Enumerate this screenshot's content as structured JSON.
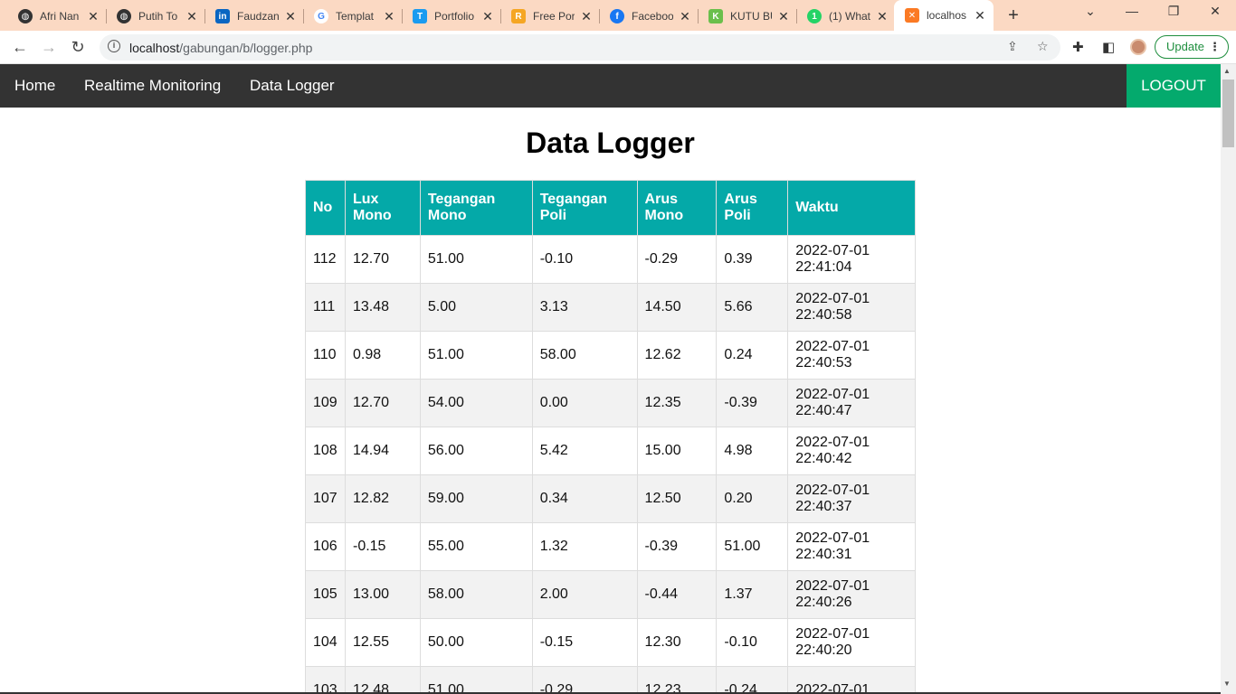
{
  "browser": {
    "tabs": [
      {
        "title": "Afri Nan",
        "icon": "globe-icon"
      },
      {
        "title": "Putih To",
        "icon": "globe-icon"
      },
      {
        "title": "Faudzan",
        "icon": "linkedin-icon"
      },
      {
        "title": "Templat",
        "icon": "google-icon"
      },
      {
        "title": "Portfolio",
        "icon": "t-app-icon"
      },
      {
        "title": "Free Por",
        "icon": "r-app-icon"
      },
      {
        "title": "Faceboo",
        "icon": "facebook-icon"
      },
      {
        "title": "KUTU BU",
        "icon": "app-icon"
      },
      {
        "title": "(1) What",
        "icon": "whatsapp-icon"
      },
      {
        "title": "localhos",
        "icon": "xampp-icon"
      }
    ],
    "url_host": "localhost",
    "url_path": "/gabungan/b/logger.php",
    "update_label": "Update"
  },
  "nav": {
    "home": "Home",
    "realtime": "Realtime Monitoring",
    "logger": "Data Logger",
    "logout": "LOGOUT"
  },
  "page": {
    "title": "Data Logger"
  },
  "table": {
    "headers": [
      [
        "No",
        ""
      ],
      [
        "Lux",
        "Mono"
      ],
      [
        "Tegangan",
        "Mono"
      ],
      [
        "Tegangan",
        "Poli"
      ],
      [
        "Arus",
        "Mono"
      ],
      [
        "Arus",
        "Poli"
      ],
      [
        "Waktu",
        ""
      ]
    ],
    "rows": [
      [
        "112",
        "12.70",
        "51.00",
        "-0.10",
        "-0.29",
        "0.39",
        "2022-07-01",
        "22:41:04"
      ],
      [
        "111",
        "13.48",
        "5.00",
        "3.13",
        "14.50",
        "5.66",
        "2022-07-01",
        "22:40:58"
      ],
      [
        "110",
        "0.98",
        "51.00",
        "58.00",
        "12.62",
        "0.24",
        "2022-07-01",
        "22:40:53"
      ],
      [
        "109",
        "12.70",
        "54.00",
        "0.00",
        "12.35",
        "-0.39",
        "2022-07-01",
        "22:40:47"
      ],
      [
        "108",
        "14.94",
        "56.00",
        "5.42",
        "15.00",
        "4.98",
        "2022-07-01",
        "22:40:42"
      ],
      [
        "107",
        "12.82",
        "59.00",
        "0.34",
        "12.50",
        "0.20",
        "2022-07-01",
        "22:40:37"
      ],
      [
        "106",
        "-0.15",
        "55.00",
        "1.32",
        "-0.39",
        "51.00",
        "2022-07-01",
        "22:40:31"
      ],
      [
        "105",
        "13.00",
        "58.00",
        "2.00",
        "-0.44",
        "1.37",
        "2022-07-01",
        "22:40:26"
      ],
      [
        "104",
        "12.55",
        "50.00",
        "-0.15",
        "12.30",
        "-0.10",
        "2022-07-01",
        "22:40:20"
      ],
      [
        "103",
        "12.48",
        "51.00",
        "-0.29",
        "12.23",
        "-0.24",
        "2022-07-01",
        ""
      ]
    ]
  },
  "colors": {
    "nav_bg": "#333333",
    "logout_bg": "#04aa6d",
    "table_header_bg": "#04a9a8",
    "tabstrip_bg": "#fbd9c3"
  }
}
